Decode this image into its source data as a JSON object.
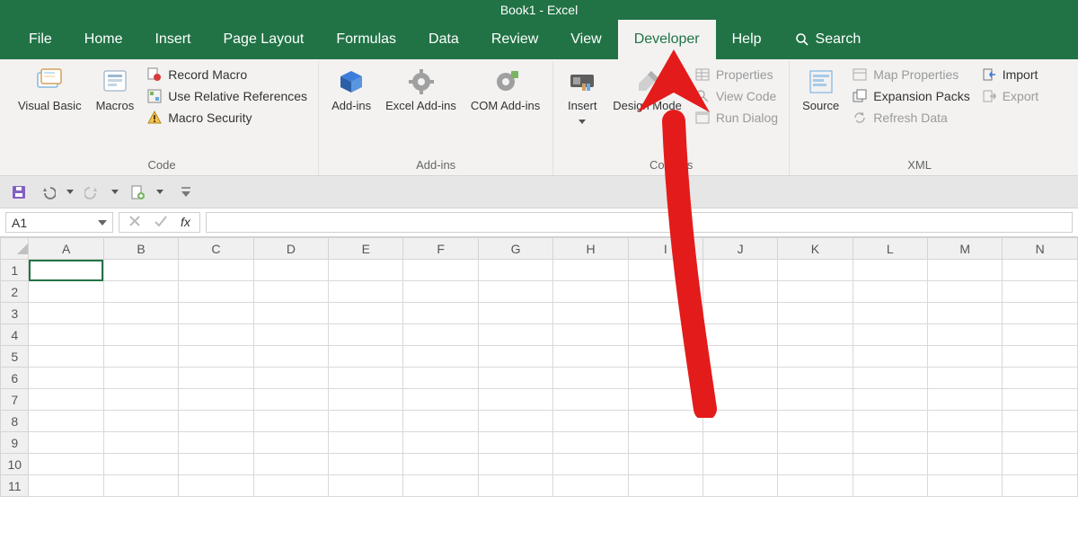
{
  "title": "Book1  -  Excel",
  "tabs": {
    "file": "File",
    "home": "Home",
    "insert": "Insert",
    "pagelayout": "Page Layout",
    "formulas": "Formulas",
    "data": "Data",
    "review": "Review",
    "view": "View",
    "developer": "Developer",
    "help": "Help",
    "search": "Search"
  },
  "ribbon": {
    "code": {
      "visual_basic": "Visual Basic",
      "macros": "Macros",
      "record_macro": "Record Macro",
      "use_relative": "Use Relative References",
      "macro_security": "Macro Security",
      "label": "Code"
    },
    "addins": {
      "addins": "Add-ins",
      "excel_addins": "Excel Add-ins",
      "com_addins": "COM Add-ins",
      "label": "Add-ins"
    },
    "controls": {
      "insert": "Insert",
      "design_mode": "Design Mode",
      "properties": "Properties",
      "view_code": "View Code",
      "run_dialog": "Run Dialog",
      "label": "Controls"
    },
    "xml": {
      "source": "Source",
      "map_properties": "Map Properties",
      "expansion_packs": "Expansion Packs",
      "refresh_data": "Refresh Data",
      "import": "Import",
      "export": "Export",
      "label": "XML"
    }
  },
  "namebox": "A1",
  "fx_label": "fx",
  "columns": [
    "A",
    "B",
    "C",
    "D",
    "E",
    "F",
    "G",
    "H",
    "I",
    "J",
    "K",
    "L",
    "M",
    "N"
  ],
  "rows": [
    "1",
    "2",
    "3",
    "4",
    "5",
    "6",
    "7",
    "8",
    "9",
    "10",
    "11"
  ]
}
